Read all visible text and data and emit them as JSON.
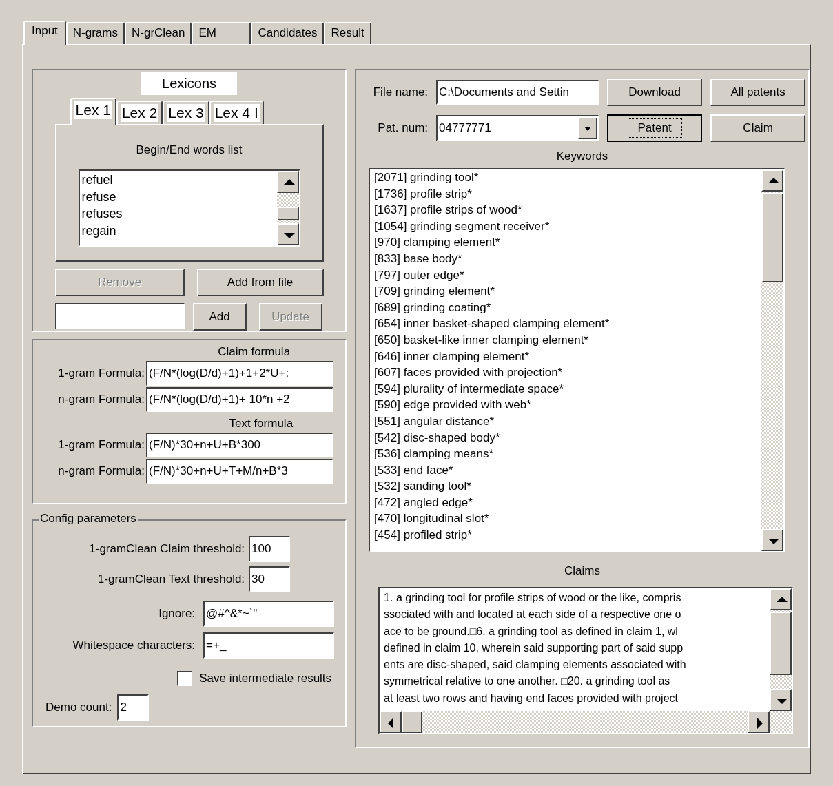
{
  "tabs": [
    {
      "label": "Input",
      "selected": true
    },
    {
      "label": "N-grams",
      "selected": false
    },
    {
      "label": "N-grClean",
      "selected": false
    },
    {
      "label": "EM",
      "selected": false
    },
    {
      "label": "Candidates",
      "selected": false
    },
    {
      "label": "Result",
      "selected": false
    }
  ],
  "lexicons": {
    "title": "Lexicons",
    "tabs": [
      {
        "label": "Lex 1",
        "selected": true
      },
      {
        "label": "Lex 2",
        "selected": false
      },
      {
        "label": "Lex 3",
        "selected": false
      },
      {
        "label": "Lex 4 I",
        "selected": false
      }
    ],
    "list_title": "Begin/End words list",
    "words": [
      "refuel",
      "refuse",
      "refuses",
      "regain"
    ],
    "remove_button": {
      "label": "Remove",
      "disabled": true
    },
    "add_from_file_button": {
      "label": "Add from file",
      "disabled": false
    },
    "add_button": {
      "label": "Add",
      "disabled": false
    },
    "update_button": {
      "label": "Update",
      "disabled": true
    }
  },
  "formula": {
    "claim_title": "Claim formula",
    "claim_rows": [
      {
        "label": "1-gram Formula:",
        "value": "(F/N*(log(D/d)+1)+1+2*U+:"
      },
      {
        "label": "n-gram Formula:",
        "value": "(F/N*(log(D/d)+1)+ 10*n +2"
      }
    ],
    "text_title": "Text formula",
    "text_rows": [
      {
        "label": "1-gram Formula:",
        "value": "(F/N)*30+n+U+B*300"
      },
      {
        "label": "n-gram Formula:",
        "value": "(F/N)*30+n+U+T+M/n+B*3"
      }
    ]
  },
  "config": {
    "title": "Config parameters",
    "thresholds": [
      {
        "label": "1-gramClean Claim threshold:",
        "value": "100"
      },
      {
        "label": "1-gramClean Text threshold:",
        "value": "30"
      }
    ],
    "fields": [
      {
        "label": "Ignore:",
        "value": "@#^&*~`\""
      },
      {
        "label": "Whitespace characters:",
        "value": "=+_"
      }
    ],
    "save": {
      "label": "Save intermediate results",
      "checked": false
    },
    "demo": {
      "label": "Demo count:",
      "value": "2"
    }
  },
  "file": {
    "label": "File name:",
    "value": "C:\\Documents and Settin"
  },
  "patent": {
    "label": "Pat. num:",
    "value": "04777771"
  },
  "buttons": [
    {
      "label": "Download",
      "focused": false
    },
    {
      "label": "All patents",
      "focused": false
    },
    {
      "label": "Patent",
      "focused": true
    },
    {
      "label": "Claim",
      "focused": false
    }
  ],
  "keywords": {
    "title": "Keywords",
    "items": [
      "[2071] grinding tool*",
      "[1736] profile strip*",
      "[1637] profile strips of wood*",
      "[1054] grinding segment receiver*",
      "[970] clamping element*",
      "[833] base body*",
      "[797] outer edge*",
      "[709] grinding element*",
      "[689] grinding coating*",
      "[654] inner basket-shaped clamping element*",
      "[650] basket-like inner clamping element*",
      "[646] inner clamping element*",
      "[607] faces provided with projection*",
      "[594] plurality of intermediate space*",
      "[590] edge provided with web*",
      "[551] angular distance*",
      "[542] disc-shaped body*",
      "[536] clamping means*",
      "[533] end face*",
      "[532] sanding tool*",
      "[472] angled edge*",
      "[470] longitudinal slot*",
      "[454] profiled strip*"
    ]
  },
  "claims": {
    "title": "Claims",
    "lines": [
      "1. a grinding tool for profile strips of wood or the like, compris",
      "ssociated with and located at each side of a respective one o",
      "ace to be ground.□6. a grinding tool as defined in claim 1, wl",
      "defined in claim 10, wherein said supporting part of said supp",
      "ents are disc-shaped, said clamping elements associated with",
      "symmetrical relative to one another. □20. a grinding tool as",
      "at least two rows and having end faces provided with project"
    ]
  }
}
